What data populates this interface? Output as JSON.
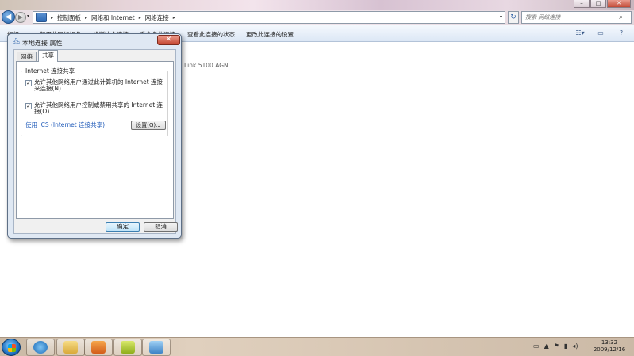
{
  "explorer": {
    "window_controls": {
      "minimize": "–",
      "maximize": "□",
      "close": "✕"
    },
    "breadcrumbs": [
      "控制面板",
      "网络和 Internet",
      "网络连接"
    ],
    "search_placeholder": "搜索 网络连接",
    "commands": [
      "组织 ▾",
      "禁用此网络设备",
      "诊断这个连接",
      "重命名此连接",
      "查看此连接的状态",
      "更改此连接的设置"
    ],
    "content_text": "Link 5100 AGN"
  },
  "dialog": {
    "title": "本地连接 属性",
    "tabs": [
      "网络",
      "共享"
    ],
    "active_tab": "共享",
    "group_title": "Internet 连接共享",
    "checks": [
      {
        "label": "允许其他网络用户通过此计算机的 Internet 连接来连接(N)",
        "checked": true
      },
      {
        "label": "允许其他网络用户控制或禁用共享的 Internet 连接(O)",
        "checked": true
      }
    ],
    "ics_link": "使用 ICS (Internet 连接共享)",
    "settings_button": "设置(G)...",
    "ok_button": "确定",
    "cancel_button": "取消"
  },
  "taskbar": {
    "clock_time": "13:32",
    "clock_date": "2009/12/16"
  },
  "colors": {
    "accent_blue": "#1c58b8",
    "dialog_frame": "#dfe8f3",
    "close_red": "#c3442e"
  },
  "icons": [
    "back-icon",
    "forward-icon",
    "network-folder-icon",
    "refresh-icon",
    "search-icon",
    "view-options-icon",
    "preview-pane-icon",
    "help-icon",
    "network-connection-icon",
    "windows-start-icon",
    "ie-icon",
    "explorer-icon",
    "media-player-icon",
    "download-icon",
    "remote-desktop-icon",
    "flag-icon",
    "network-tray-icon",
    "volume-icon"
  ]
}
